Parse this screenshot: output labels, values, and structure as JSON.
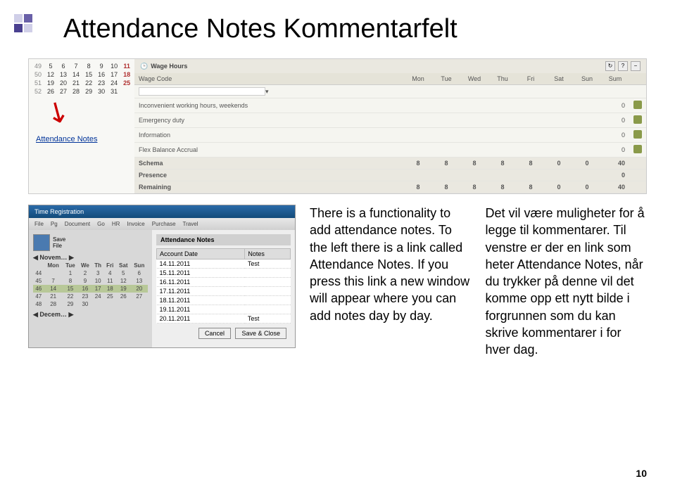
{
  "title": "Attendance Notes    Kommentarfelt",
  "calendar": {
    "rows": [
      {
        "wk": "49",
        "days": [
          "5",
          "6",
          "7",
          "8",
          "9",
          "10",
          "11"
        ]
      },
      {
        "wk": "50",
        "days": [
          "12",
          "13",
          "14",
          "15",
          "16",
          "17",
          "18"
        ]
      },
      {
        "wk": "51",
        "days": [
          "19",
          "20",
          "21",
          "22",
          "23",
          "24",
          "25"
        ]
      },
      {
        "wk": "52",
        "days": [
          "26",
          "27",
          "28",
          "29",
          "30",
          "31",
          ""
        ]
      }
    ]
  },
  "attendance_link": "Attendance Notes",
  "wage_panel": {
    "title": "Wage Hours",
    "headers": [
      "Wage Code",
      "Mon",
      "Tue",
      "Wed",
      "Thu",
      "Fri",
      "Sat",
      "Sun",
      "Sum"
    ],
    "rows": [
      {
        "label": "Inconvenient working hours, weekends",
        "sum": "0"
      },
      {
        "label": "Emergency duty",
        "sum": "0"
      },
      {
        "label": "Information",
        "sum": "0"
      },
      {
        "label": "Flex Balance Accrual",
        "sum": "0"
      }
    ],
    "section_rows": [
      {
        "label": "Schema",
        "vals": [
          "8",
          "8",
          "8",
          "8",
          "8",
          "0",
          "0",
          "40"
        ]
      },
      {
        "label": "Presence",
        "vals": [
          "",
          "",
          "",
          "",
          "",
          "",
          "",
          "0"
        ]
      },
      {
        "label": "Remaining",
        "vals": [
          "8",
          "8",
          "8",
          "8",
          "8",
          "0",
          "0",
          "40"
        ]
      }
    ]
  },
  "screenshot2": {
    "menubar": "Time Registration",
    "toolbar_items": [
      "File",
      "Pg",
      "Document",
      "Go",
      "HR",
      "Invoice",
      "Purchase",
      "Travel"
    ],
    "save_label": "Save",
    "file_label": "File",
    "cal_month": "Novem…",
    "cal_headers": [
      "Mon",
      "Tue",
      "We",
      "Th",
      "Fri",
      "Sat",
      "Sun"
    ],
    "cal_rows": [
      [
        "44",
        "",
        "1",
        "2",
        "3",
        "4",
        "5",
        "6"
      ],
      [
        "45",
        "7",
        "8",
        "9",
        "10",
        "11",
        "12",
        "13"
      ],
      [
        "46",
        "14",
        "15",
        "16",
        "17",
        "18",
        "19",
        "20"
      ],
      [
        "47",
        "21",
        "22",
        "23",
        "24",
        "25",
        "26",
        "27"
      ],
      [
        "48",
        "28",
        "29",
        "30",
        "",
        "",
        "",
        ""
      ]
    ],
    "highlight_row_index": 2,
    "dec_label": "Decem…",
    "notes_title": "Attendance Notes",
    "notes_headers": [
      "Account Date",
      "Notes"
    ],
    "notes_rows": [
      {
        "date": "14.11.2011",
        "note": "Test"
      },
      {
        "date": "15.11.2011",
        "note": ""
      },
      {
        "date": "16.11.2011",
        "note": ""
      },
      {
        "date": "17.11.2011",
        "note": ""
      },
      {
        "date": "18.11.2011",
        "note": ""
      },
      {
        "date": "19.11.2011",
        "note": ""
      },
      {
        "date": "20.11.2011",
        "note": "Test"
      }
    ],
    "cancel": "Cancel",
    "save_close": "Save & Close"
  },
  "text_en": "There is a functionality to add attendance notes. To the left there is a link called Attendance Notes. If you press this link a new window will appear where you can add notes day by day.",
  "text_no": "Det vil være muligheter for å legge til kommentarer. Til venstre er der en link som heter Attendance Notes, når du trykker på denne vil det komme opp ett nytt bilde i forgrunnen som du kan skrive kommentarer i for hver dag.",
  "page_num": "10"
}
